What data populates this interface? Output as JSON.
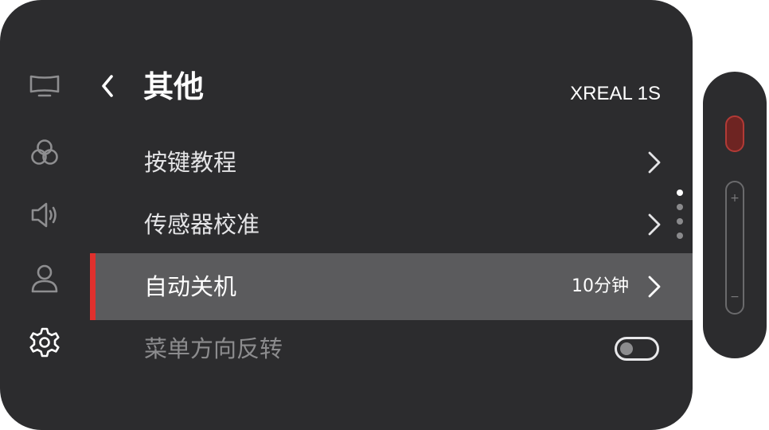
{
  "header": {
    "title": "其他",
    "device_name": "XREAL 1S"
  },
  "sidebar": {
    "items": [
      {
        "icon": "display-icon",
        "selected": false
      },
      {
        "icon": "color-circles-icon",
        "selected": false
      },
      {
        "icon": "speaker-icon",
        "selected": false
      },
      {
        "icon": "user-icon",
        "selected": false
      },
      {
        "icon": "gear-icon",
        "selected": true
      }
    ]
  },
  "menu": {
    "items": [
      {
        "label": "按键教程",
        "value": "",
        "control": "chevron",
        "state": "normal"
      },
      {
        "label": "传感器校准",
        "value": "",
        "control": "chevron",
        "state": "normal"
      },
      {
        "label": "自动关机",
        "value": "10分钟",
        "control": "chevron",
        "state": "selected"
      },
      {
        "label": "菜单方向反转",
        "value": "",
        "control": "toggle",
        "toggle_on": false,
        "state": "dimmed"
      }
    ]
  },
  "pagination": {
    "pages": 4,
    "current": 1
  },
  "controller": {
    "plus_label": "+",
    "minus_label": "−"
  },
  "colors": {
    "panel_bg": "#2c2c2e",
    "selected_row_bg": "#5b5b5d",
    "accent": "#e0302d",
    "controller_button": "#6e2422"
  }
}
